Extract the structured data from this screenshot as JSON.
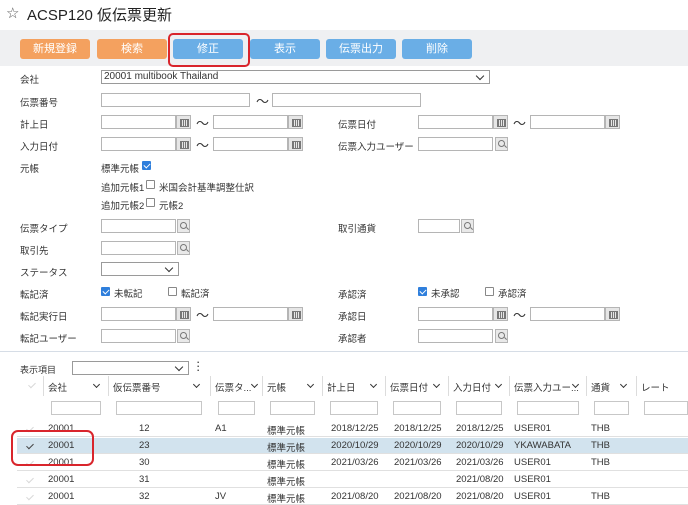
{
  "header": {
    "title": "ACSP120 仮伝票更新"
  },
  "toolbar": {
    "new": "新規登録",
    "search": "検索",
    "edit": "修正",
    "view": "表示",
    "print": "伝票出力",
    "delete": "削除"
  },
  "form": {
    "company_label": "会社",
    "company_value": "20001 multibook Thailand",
    "voucher_no_label": "伝票番号",
    "post_date_label": "計上日",
    "voucher_date_label": "伝票日付",
    "input_date_label": "入力日付",
    "input_user_label": "伝票入力ユーザー",
    "ledger_label": "元帳",
    "ledger_standard": "標準元帳",
    "ledger_add1_label": "追加元帳1",
    "ledger_add1_value": "米国会計基準調整仕訳",
    "ledger_add2_label": "追加元帳2",
    "ledger_add2_value": "元帳2",
    "voucher_type_label": "伝票タイプ",
    "currency_label": "取引通貨",
    "partner_label": "取引先",
    "status_label": "ステータス",
    "posted_label": "転記済",
    "unposted_option": "未転記",
    "posted_option": "転記済",
    "approved_label": "承認済",
    "unapproved_option": "未承認",
    "approved_option": "承認済",
    "post_exec_date_label": "転記実行日",
    "approval_date_label": "承認日",
    "post_user_label": "転記ユーザー",
    "approver_label": "承認者",
    "tilde": "〜"
  },
  "grid": {
    "display_items_label": "表示項目",
    "columns": [
      "会社",
      "仮伝票番号",
      "伝票タ...",
      "元帳",
      "計上日",
      "伝票日付",
      "入力日付",
      "伝票入力ユー...",
      "通貨",
      "レート"
    ],
    "rows": [
      {
        "company": "20001",
        "no": "12",
        "type": "A1",
        "ledger": "標準元帳",
        "post": "2018/12/25",
        "vdate": "2018/12/25",
        "idate": "2018/12/25",
        "user": "USER01",
        "cur": "THB",
        "selected": false
      },
      {
        "company": "20001",
        "no": "23",
        "type": "",
        "ledger": "標準元帳",
        "post": "2020/10/29",
        "vdate": "2020/10/29",
        "idate": "2020/10/29",
        "user": "YKAWABATA",
        "cur": "THB",
        "selected": true
      },
      {
        "company": "20001",
        "no": "30",
        "type": "",
        "ledger": "標準元帳",
        "post": "2021/03/26",
        "vdate": "2021/03/26",
        "idate": "2021/03/26",
        "user": "USER01",
        "cur": "THB",
        "selected": false
      },
      {
        "company": "20001",
        "no": "31",
        "type": "",
        "ledger": "標準元帳",
        "post": "",
        "vdate": "",
        "idate": "2021/08/20",
        "user": "USER01",
        "cur": "",
        "selected": false
      },
      {
        "company": "20001",
        "no": "32",
        "type": "JV",
        "ledger": "標準元帳",
        "post": "2021/08/20",
        "vdate": "2021/08/20",
        "idate": "2021/08/20",
        "user": "USER01",
        "cur": "THB",
        "selected": false
      }
    ]
  },
  "colors": {
    "orange": "#f4a15f",
    "blue": "#6aaee6",
    "highlight": "#d9252c",
    "checkbox": "#2f7fdc",
    "selected_row": "#d2e3ee"
  }
}
